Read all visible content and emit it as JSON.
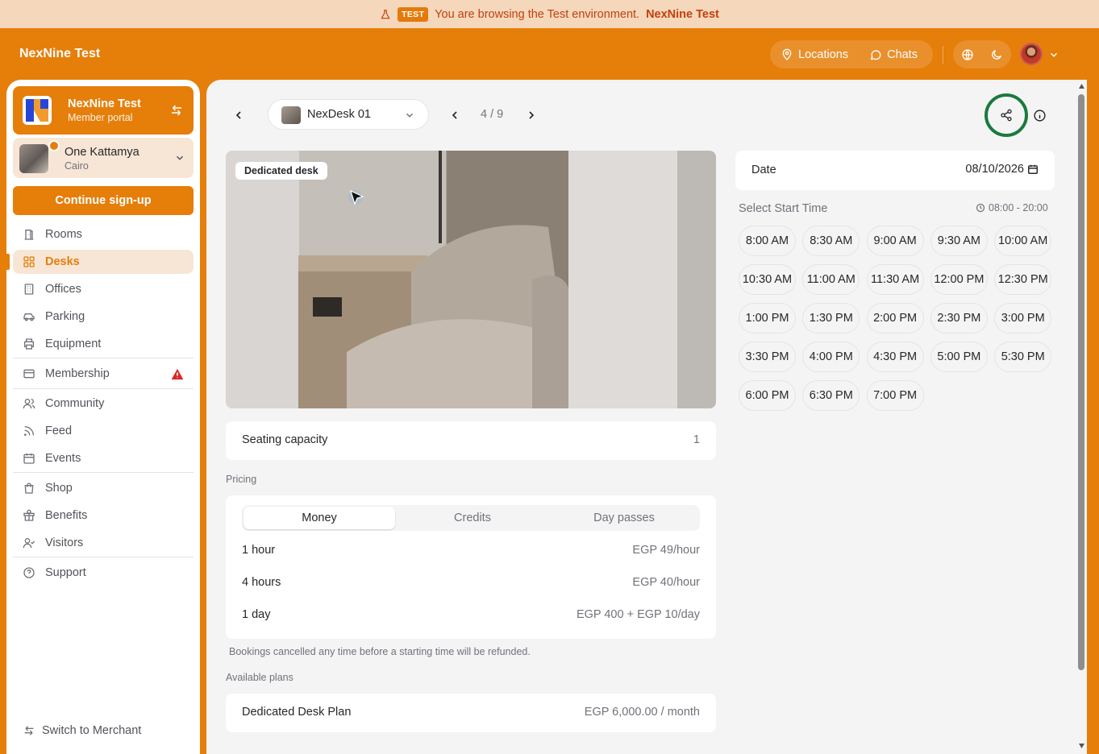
{
  "banner": {
    "badge": "TEST",
    "text": "You are browsing the Test environment.",
    "env_name": "NexNine Test"
  },
  "topbar": {
    "brand": "NexNine Test",
    "locations": "Locations",
    "chats": "Chats"
  },
  "sidebar": {
    "portal_name": "NexNine Test",
    "portal_subtitle": "Member portal",
    "location_name": "One Kattamya",
    "location_city": "Cairo",
    "cta": "Continue sign-up",
    "items": [
      {
        "label": "Rooms"
      },
      {
        "label": "Desks"
      },
      {
        "label": "Offices"
      },
      {
        "label": "Parking"
      },
      {
        "label": "Equipment"
      },
      {
        "label": "Membership"
      },
      {
        "label": "Community"
      },
      {
        "label": "Feed"
      },
      {
        "label": "Events"
      },
      {
        "label": "Shop"
      },
      {
        "label": "Benefits"
      },
      {
        "label": "Visitors"
      },
      {
        "label": "Support"
      }
    ],
    "switch_label": "Switch to Merchant"
  },
  "header": {
    "desk_name": "NexDesk 01",
    "pager": "4 / 9"
  },
  "photo": {
    "tag": "Dedicated desk"
  },
  "details": {
    "capacity_label": "Seating capacity",
    "capacity_value": "1",
    "pricing_label": "Pricing",
    "tabs": [
      "Money",
      "Credits",
      "Day passes"
    ],
    "prices": [
      {
        "label": "1 hour",
        "value": "EGP 49/hour"
      },
      {
        "label": "4 hours",
        "value": "EGP 40/hour"
      },
      {
        "label": "1 day",
        "value": "EGP 400 + EGP 10/day"
      }
    ],
    "refund_note": "Bookings cancelled any time before a starting time will be refunded.",
    "plans_label": "Available plans",
    "plan_name": "Dedicated Desk Plan",
    "plan_price": "EGP 6,000.00 / month"
  },
  "booking": {
    "date_label": "Date",
    "date_value": "08/10/2026",
    "start_label": "Select Start Time",
    "hours": "08:00 - 20:00",
    "slots": [
      "8:00 AM",
      "8:30 AM",
      "9:00 AM",
      "9:30 AM",
      "10:00 AM",
      "10:30 AM",
      "11:00 AM",
      "11:30 AM",
      "12:00 PM",
      "12:30 PM",
      "1:00 PM",
      "1:30 PM",
      "2:00 PM",
      "2:30 PM",
      "3:00 PM",
      "3:30 PM",
      "4:00 PM",
      "4:30 PM",
      "5:00 PM",
      "5:30 PM",
      "6:00 PM",
      "6:30 PM",
      "7:00 PM"
    ]
  },
  "colors": {
    "accent": "#e67e0a",
    "share_ring": "#1a7a3c"
  }
}
